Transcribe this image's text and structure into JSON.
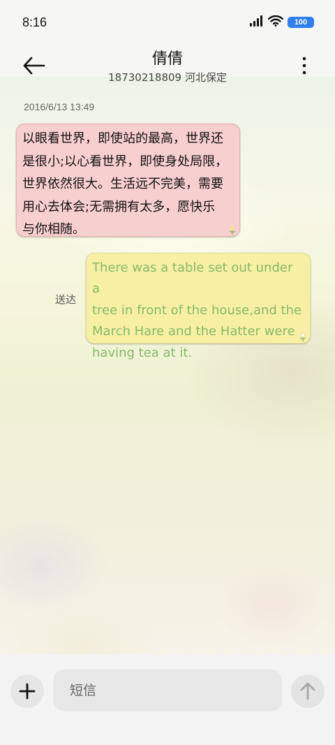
{
  "status_bar": {
    "time": "8:16",
    "battery": "100",
    "icons": [
      "signal-icon",
      "wifi-icon",
      "battery-icon"
    ]
  },
  "header": {
    "contact_name": "倩倩",
    "contact_details": "18730218809 河北保定",
    "back_icon": "arrow-left-icon",
    "more_icon": "more-vertical-icon"
  },
  "conversation": {
    "timestamp": "2016/6/13 13:49",
    "messages": [
      {
        "direction": "incoming",
        "lines": [
          "以眼看世界，即使站的最高，世界还",
          "是很小;以心看世界，即使身处局限，",
          "世界依然很大。生活远不完美，需要",
          "用心去体会;无需拥有太多，愿快乐",
          "与你相随。"
        ],
        "bubble_color": "#f8cfcf"
      },
      {
        "direction": "outgoing",
        "lines": [
          "There was a table set out under a",
          "tree in front of the house,and the",
          "March Hare and the Hatter were",
          "having tea at it."
        ],
        "status": "送达",
        "bubble_color": "#f7f0a4",
        "text_color": "#86b96a"
      }
    ]
  },
  "composer": {
    "placeholder": "短信",
    "add_icon": "plus-icon",
    "send_icon": "arrow-up-icon"
  }
}
